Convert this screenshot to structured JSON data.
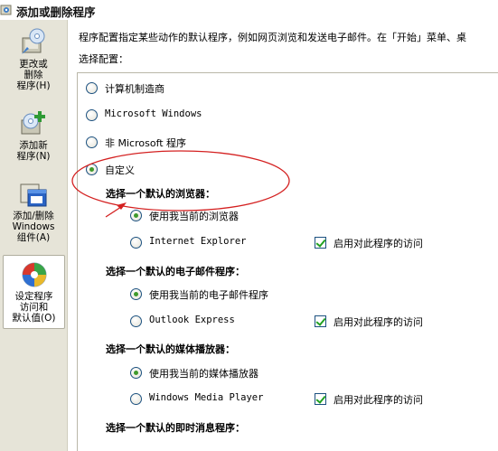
{
  "window": {
    "title": "添加或删除程序"
  },
  "sidebar": {
    "items": [
      {
        "label_lines": [
          "更改或",
          "删除",
          "程序(H)"
        ],
        "icon": "change-remove-programs-icon"
      },
      {
        "label_lines": [
          "添加新",
          "程序(N)"
        ],
        "icon": "add-new-programs-icon"
      },
      {
        "label_lines": [
          "添加/删除",
          "Windows",
          "组件(A)"
        ],
        "icon": "windows-components-icon"
      },
      {
        "label_lines": [
          "设定程序",
          "访问和",
          "默认值(O)"
        ],
        "icon": "set-program-defaults-icon",
        "active": true
      }
    ]
  },
  "main": {
    "intro": "程序配置指定某些动作的默认程序，例如网页浏览和发送电子邮件。在「开始」菜单、桌",
    "select_label": "选择配置：",
    "configs": [
      {
        "label": "计算机制造商",
        "selected": false
      },
      {
        "label": "Microsoft Windows",
        "selected": false
      },
      {
        "label": "非 Microsoft 程序",
        "selected": false
      },
      {
        "label": "自定义",
        "selected": true
      }
    ],
    "sections": [
      {
        "heading": "选择一个默认的浏览器：",
        "current_option": "使用我当前的浏览器",
        "current_selected": true,
        "program_option": "Internet Explorer",
        "program_selected": false,
        "enable_access_label": "启用对此程序的访问",
        "enable_access_checked": true
      },
      {
        "heading": "选择一个默认的电子邮件程序：",
        "current_option": "使用我当前的电子邮件程序",
        "current_selected": true,
        "program_option": "Outlook Express",
        "program_selected": false,
        "enable_access_label": "启用对此程序的访问",
        "enable_access_checked": true
      },
      {
        "heading": "选择一个默认的媒体播放器：",
        "current_option": "使用我当前的媒体播放器",
        "current_selected": true,
        "program_option": "Windows Media Player",
        "program_selected": false,
        "enable_access_label": "启用对此程序的访问",
        "enable_access_checked": true
      },
      {
        "heading": "选择一个默认的即时消息程序："
      }
    ]
  },
  "colors": {
    "sidebar_bg": "#e6e4d8",
    "radio_dot": "#3f9a2b",
    "check_mark": "#21a121",
    "annotation": "#d42020"
  }
}
